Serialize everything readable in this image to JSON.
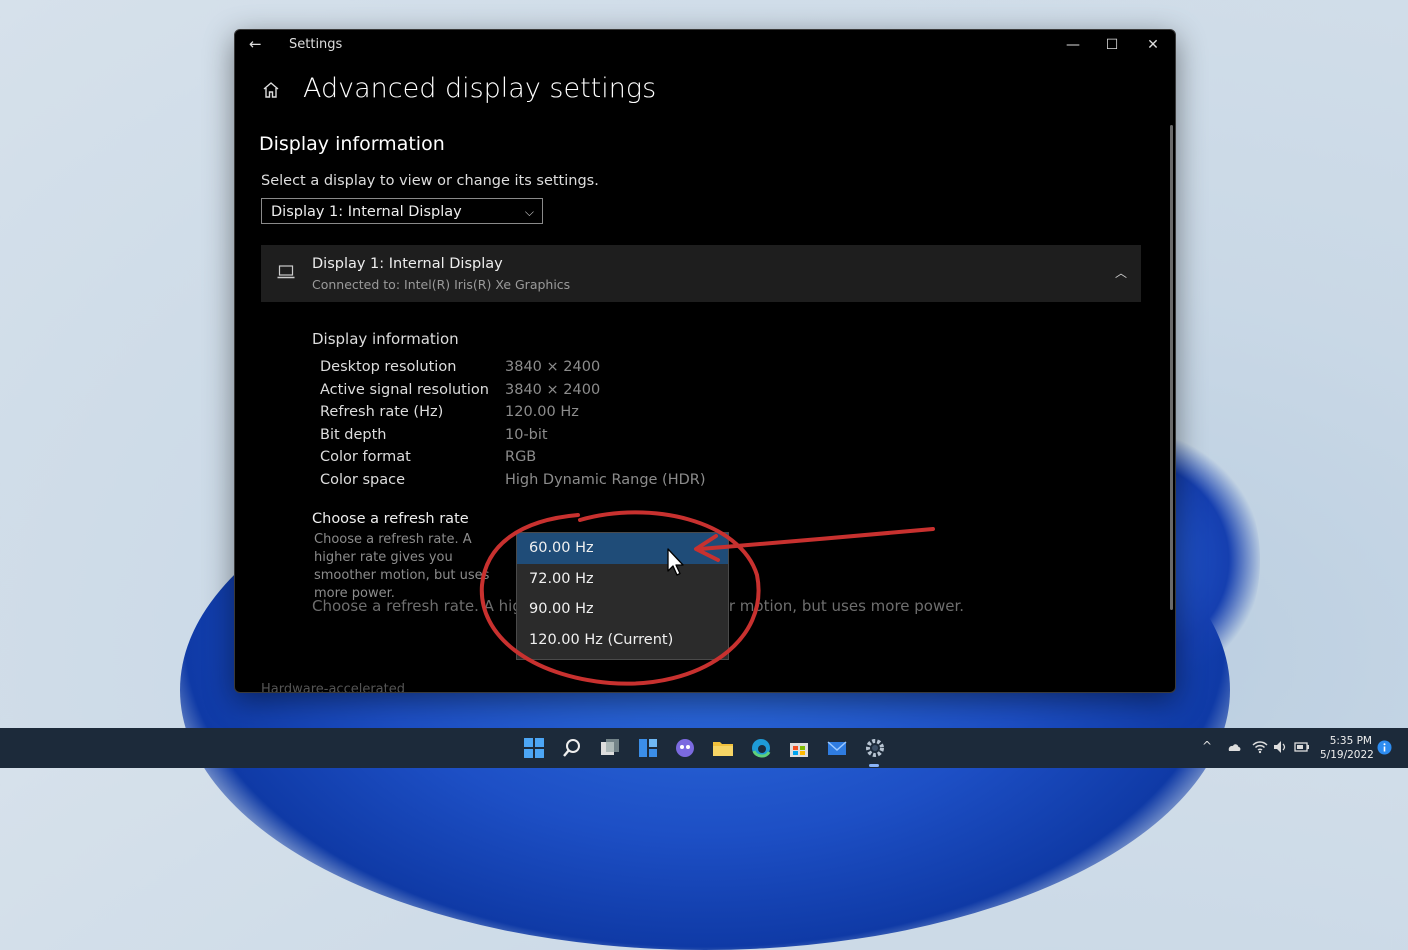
{
  "window": {
    "back_glyph": "←",
    "title": "Settings",
    "minimize_glyph": "—",
    "maximize_glyph": "☐",
    "close_glyph": "✕"
  },
  "page": {
    "title": "Advanced display settings",
    "section_title": "Display information",
    "select_label": "Select a display to view or change its settings.",
    "selected_display": "Display 1: Internal Display"
  },
  "card": {
    "name": "Display 1: Internal Display",
    "subtitle": "Connected to: Intel(R) Iris(R) Xe Graphics"
  },
  "info": {
    "heading": "Display information",
    "rows": [
      {
        "label": "Desktop resolution",
        "value": "3840 × 2400"
      },
      {
        "label": "Active signal resolution",
        "value": "3840 × 2400"
      },
      {
        "label": "Refresh rate (Hz)",
        "value": "120.00 Hz"
      },
      {
        "label": "Bit depth",
        "value": "10-bit"
      },
      {
        "label": "Color format",
        "value": "RGB"
      },
      {
        "label": "Color space",
        "value": "High Dynamic Range (HDR)"
      }
    ]
  },
  "refresh": {
    "title": "Choose a refresh rate",
    "description": "Choose a refresh rate. A higher rate gives you smoother motion, but uses more power.",
    "description_full": "Choose a refresh rate. A higher rate gives you smoother motion, but uses more power.",
    "options": [
      "60.00 Hz",
      "72.00 Hz",
      "90.00 Hz",
      "120.00 Hz (Current)"
    ],
    "highlighted_index": 0
  },
  "bottom_item": "Hardware-accelerated",
  "taskbar": {
    "time": "5:35 PM",
    "date": "5/19/2022",
    "tray_chevron": "^"
  },
  "colors": {
    "accent": "#1f4c78",
    "annotation": "#c8312f",
    "window_bg": "#000000"
  }
}
